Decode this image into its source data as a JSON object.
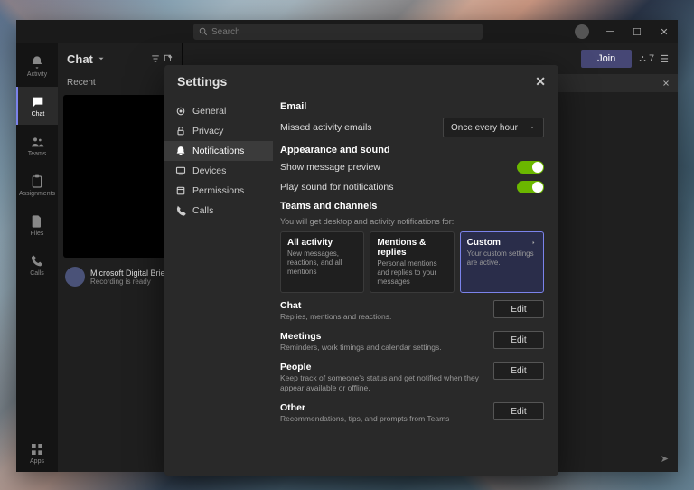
{
  "titlebar": {
    "search_placeholder": "Search"
  },
  "leftrail": {
    "items": [
      {
        "label": "Activity"
      },
      {
        "label": "Chat"
      },
      {
        "label": "Teams"
      },
      {
        "label": "Assignments"
      },
      {
        "label": "Files"
      },
      {
        "label": "Calls"
      }
    ],
    "apps": "Apps"
  },
  "chat_panel": {
    "title": "Chat",
    "tab": "Recent",
    "item_title": "Microsoft Digital Brief",
    "item_sub": "Recording is ready"
  },
  "main": {
    "join": "Join"
  },
  "settings": {
    "title": "Settings",
    "nav": [
      {
        "label": "General"
      },
      {
        "label": "Privacy"
      },
      {
        "label": "Notifications"
      },
      {
        "label": "Devices"
      },
      {
        "label": "Permissions"
      },
      {
        "label": "Calls"
      }
    ],
    "email": {
      "heading": "Email",
      "missed_label": "Missed activity emails",
      "missed_value": "Once every hour"
    },
    "appearance": {
      "heading": "Appearance and sound",
      "preview": "Show message preview",
      "sound": "Play sound for notifications"
    },
    "teams": {
      "heading": "Teams and channels",
      "sub": "You will get desktop and activity notifications for:",
      "cards": [
        {
          "title": "All activity",
          "sub": "New messages, reactions, and all mentions"
        },
        {
          "title": "Mentions & replies",
          "sub": "Personal mentions and replies to your messages"
        },
        {
          "title": "Custom",
          "sub": "Your custom settings are active."
        }
      ]
    },
    "sections": [
      {
        "title": "Chat",
        "sub": "Replies, mentions and reactions.",
        "btn": "Edit"
      },
      {
        "title": "Meetings",
        "sub": "Reminders, work timings and calendar settings.",
        "btn": "Edit"
      },
      {
        "title": "People",
        "sub": "Keep track of someone's status and get notified when they appear available or offline.",
        "btn": "Edit"
      },
      {
        "title": "Other",
        "sub": "Recommendations, tips, and prompts from Teams",
        "btn": "Edit"
      }
    ]
  }
}
